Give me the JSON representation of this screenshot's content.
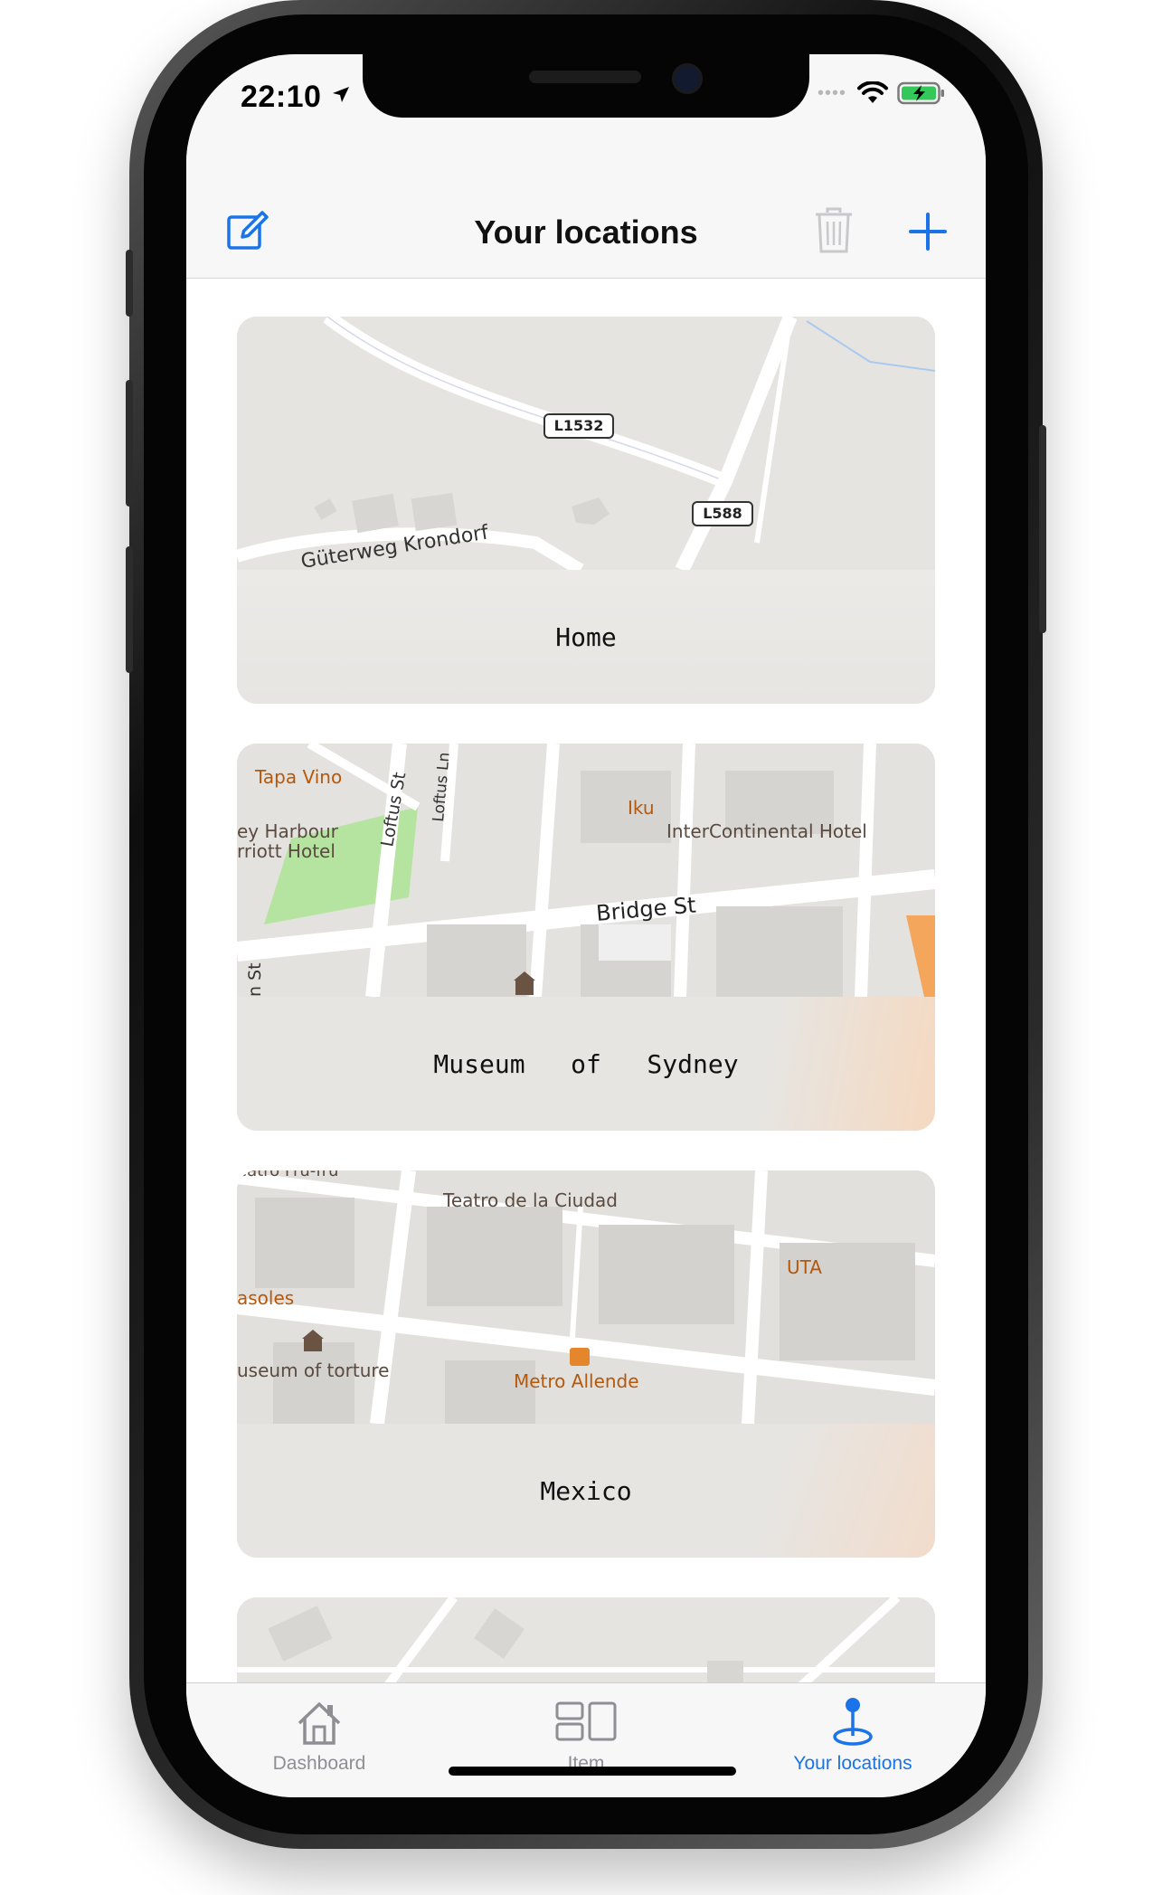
{
  "status_bar": {
    "time": "22:10"
  },
  "navbar": {
    "title": "Your locations",
    "left_icon": "compose-icon",
    "trash_icon": "trash-icon",
    "add_icon": "plus-icon",
    "accent_color": "#1a73e8"
  },
  "locations": [
    {
      "name": "Home",
      "map_labels": {
        "road1": "L1532",
        "road2": "L588",
        "street": "Güterweg Krondorf"
      }
    },
    {
      "name": "Museum   of   Sydney",
      "map_labels": {
        "poi1": "Tapa Vino",
        "poi2": "Iku",
        "poi3": "InterContinental Hotel",
        "poi4a": "ey Harbour",
        "poi4b": "rriott Hotel",
        "street1": "Loftus St",
        "street2": "Loftus Ln",
        "street3": "Bridge St",
        "street4": "n St"
      }
    },
    {
      "name": "Mexico",
      "map_labels": {
        "poi1": "Teatro de la Ciudad",
        "poi2": "UTA",
        "poi3": "asoles",
        "poi4": "useum of torture",
        "poi5": "Metro Allende",
        "poi6": "eatro Fru-fru"
      }
    },
    {
      "name": ""
    }
  ],
  "tabbar": {
    "tabs": [
      {
        "label": "Dashboard",
        "icon": "house-icon",
        "active": false
      },
      {
        "label": "Item",
        "icon": "grid-icon",
        "active": false
      },
      {
        "label": "Your locations",
        "icon": "location-pin-icon",
        "active": true
      }
    ],
    "active_color": "#1a73e8",
    "inactive_color": "#8e8e93"
  }
}
